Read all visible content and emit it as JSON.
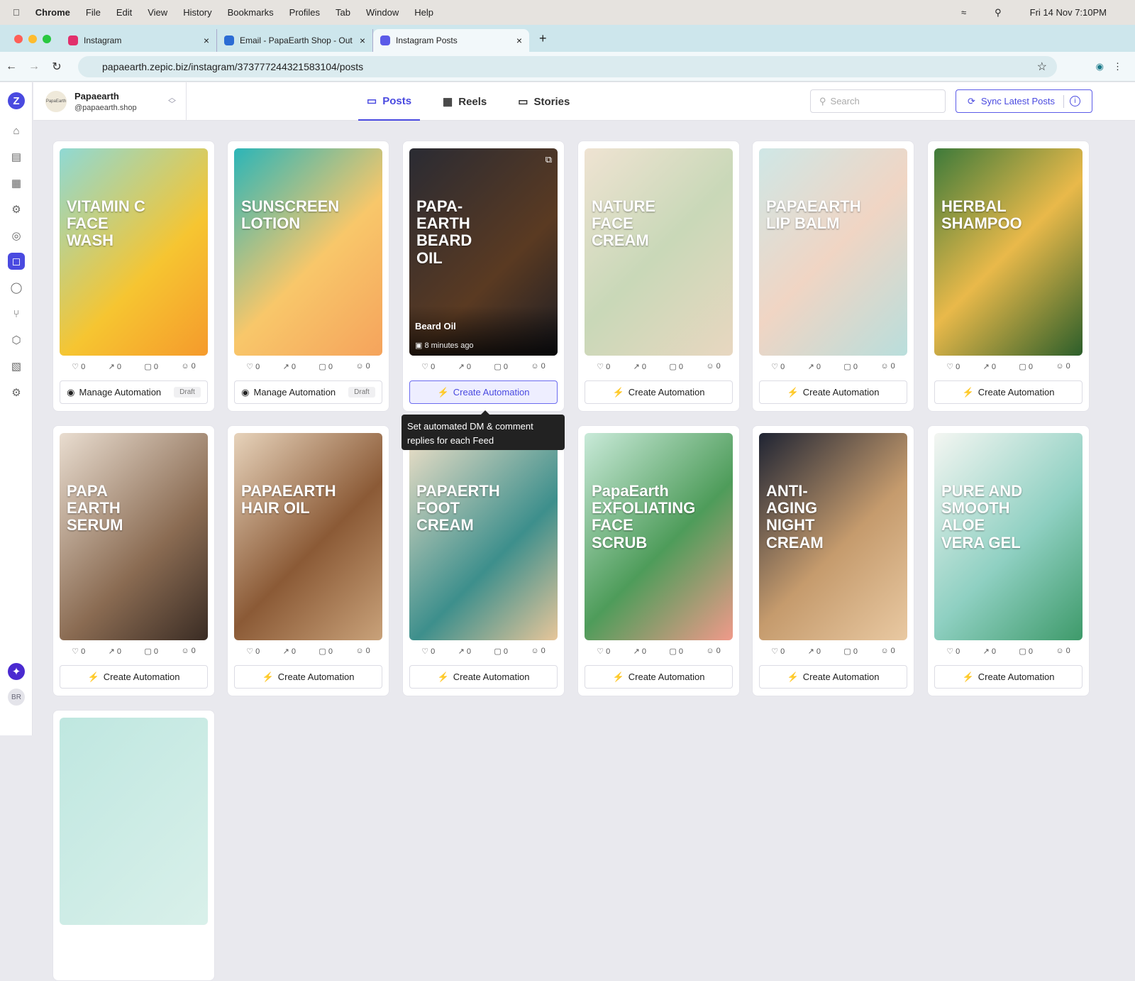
{
  "menubar": {
    "app": "Chrome",
    "items": [
      "File",
      "Edit",
      "View",
      "History",
      "Bookmarks",
      "Profiles",
      "Tab",
      "Window",
      "Help"
    ],
    "datetime": "Fri 14 Nov  7:10PM"
  },
  "tabs": [
    {
      "title": "Instagram",
      "color": "#e1306c"
    },
    {
      "title": "Email - PapaEarth Shop - Out",
      "color": "#2b6cd4"
    },
    {
      "title": "Instagram Posts",
      "color": "#5b5be8"
    }
  ],
  "url": "papaearth.zepic.biz/instagram/373777244321583104/posts",
  "account": {
    "name": "Papaearth",
    "handle": "@papaearth.shop",
    "avatar_text": "PapaEarth"
  },
  "nav_tabs": [
    "Posts",
    "Reels",
    "Stories"
  ],
  "search": {
    "placeholder": "Search"
  },
  "sync_label": "Sync Latest Posts",
  "user_initials": "BR",
  "tooltip": "Set automated DM & comment replies for each Feed",
  "stat_zero": "0",
  "posts": [
    {
      "label": "VITAMIN C FACE WASH",
      "bg": "linear-gradient(135deg,#8fd9d4,#f6c531 60%,#f59a2c)",
      "action": "Manage Automation",
      "status": "Draft"
    },
    {
      "label": "SUNSCREEN LOTION",
      "bg": "linear-gradient(135deg,#2bb5b8,#f8c76a 55%,#f5a35c)",
      "action": "Manage Automation",
      "status": "Draft"
    },
    {
      "label": "PAPA-EARTH BEARD OIL",
      "bg": "linear-gradient(135deg,#2a2b33,#5a3a22 60%,#1e1e24)",
      "action": "Create Automation",
      "title": "Beard Oil",
      "time": "8 minutes ago",
      "highlight": true
    },
    {
      "label": "NATURE FACE CREAM",
      "bg": "linear-gradient(135deg,#efe3d2,#c9d8b8 50%,#e8d7c0)",
      "action": "Create Automation"
    },
    {
      "label": "PAPAEARTH LIP BALM",
      "bg": "linear-gradient(135deg,#cfe7e6,#f0d5c4 50%,#b9dedc)",
      "action": "Create Automation"
    },
    {
      "label": "HERBAL SHAMPOO",
      "bg": "linear-gradient(135deg,#3d7a3a,#e9b94a 50%,#2c5e2a)",
      "action": "Create Automation"
    },
    {
      "label": "PAPA EARTH SERUM",
      "bg": "linear-gradient(135deg,#e9ddd0,#8a6b52 60%,#3a2c24)",
      "action": "Create Automation"
    },
    {
      "label": "PAPAEARTH HAIR OIL",
      "bg": "linear-gradient(135deg,#e7d3bb,#8b5a36 55%,#c9a27a)",
      "action": "Create Automation"
    },
    {
      "label": "PAPAERTH FOOT CREAM",
      "bg": "linear-gradient(135deg,#efe0c8,#3d8f8c 60%,#e7c69a)",
      "action": "Create Automation"
    },
    {
      "label": "PapaEarth EXFOLIATING FACE SCRUB",
      "bg": "linear-gradient(135deg,#c9ead9,#4e9c5a 55%,#f09a8a)",
      "action": "Create Automation"
    },
    {
      "label": "ANTI-AGING NIGHT CREAM",
      "bg": "linear-gradient(135deg,#1f2433,#c59b6d 55%,#e9c9a2)",
      "action": "Create Automation"
    },
    {
      "label": "PURE AND SMOOTH ALOE VERA GEL",
      "bg": "linear-gradient(135deg,#f4f6f2,#8fd0c2 55%,#3e9a6a)",
      "action": "Create Automation"
    },
    {
      "label": "",
      "bg": "linear-gradient(135deg,#bfe7e0,#d9f0ea)",
      "action": ""
    }
  ]
}
